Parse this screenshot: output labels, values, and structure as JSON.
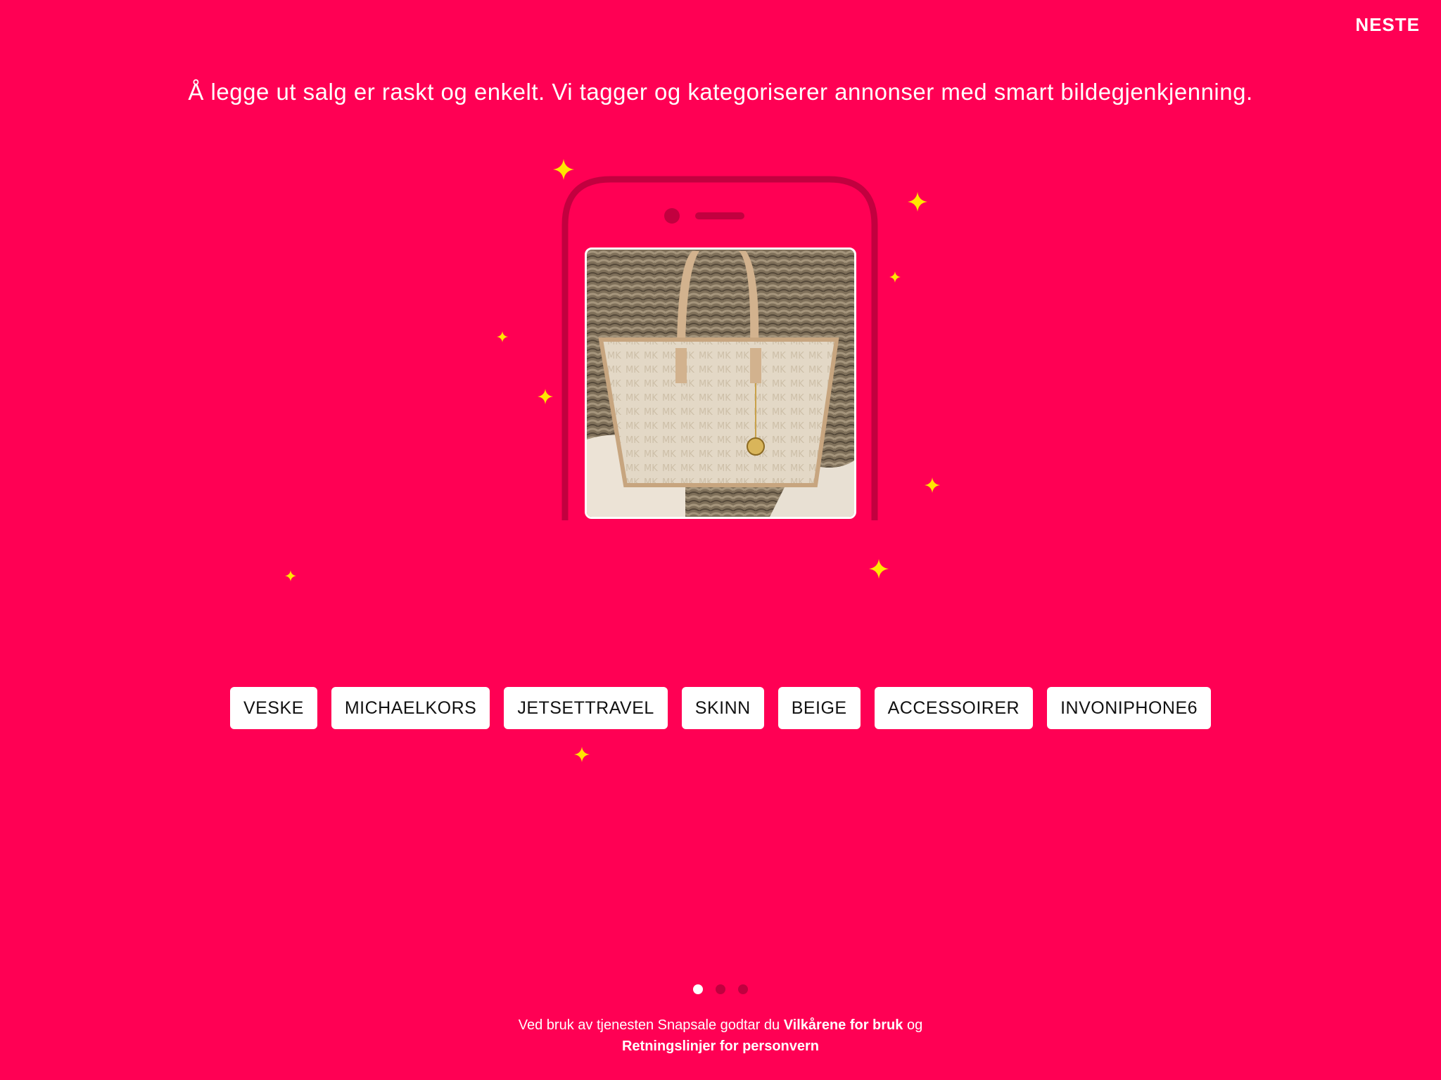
{
  "header": {
    "next_label": "NESTE"
  },
  "intro": {
    "headline": "Å legge ut salg er raskt og enkelt. Vi tagger og kategoriserer annonser med smart bildegjenkjenning."
  },
  "tags": [
    "VESKE",
    "MICHAELKORS",
    "JETSETTRAVEL",
    "SKINN",
    "BEIGE",
    "ACCESSOIRER",
    "INVONIPHONE6"
  ],
  "pager": {
    "total": 3,
    "active": 1
  },
  "footer": {
    "text_before": "Ved bruk av tjenesten Snapsale godtar du ",
    "terms_link": "Vilkårene for bruk",
    "text_middle": " og ",
    "privacy_link": "Retningslinjer for personvern"
  },
  "colors": {
    "background": "#ff0054",
    "sparkle": "#ffe600",
    "phone_outline": "#c2003f"
  },
  "icons": [
    "sparkle-icon",
    "phone-illustration",
    "handbag-photo"
  ]
}
